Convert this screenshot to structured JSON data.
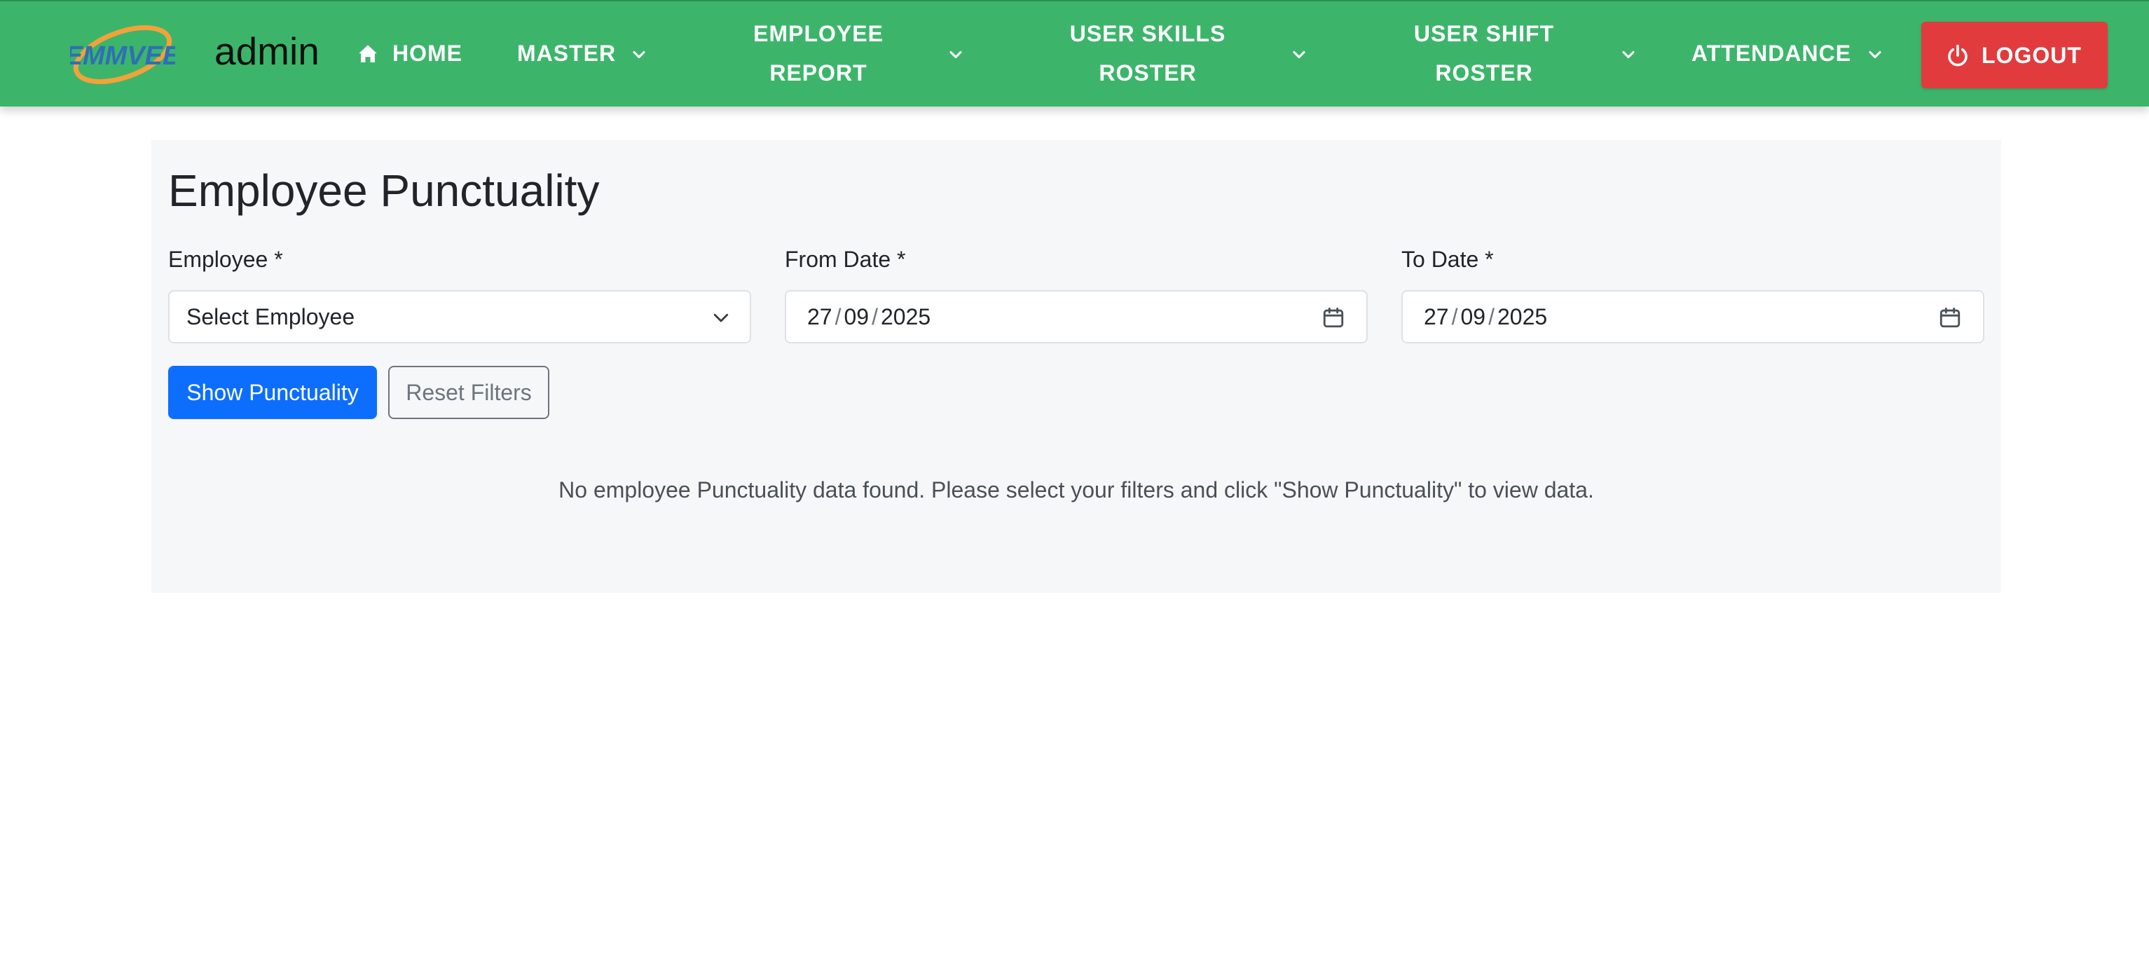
{
  "header": {
    "logo_text": "EMMVEE",
    "brand": "admin",
    "colors": {
      "navbar": "#3cb56b",
      "logout": "#e13b3e"
    },
    "nav": {
      "home": "HOME",
      "master": "MASTER",
      "employee_report_l1": "EMPLOYEE",
      "employee_report_l2": "REPORT",
      "user_skills_l1": "USER SKILLS",
      "user_skills_l2": "ROSTER",
      "user_shift_l1": "USER SHIFT",
      "user_shift_l2": "ROSTER",
      "attendance": "ATTENDANCE",
      "logout": "LOGOUT"
    }
  },
  "main": {
    "title": "Employee Punctuality",
    "employee": {
      "label": "Employee *",
      "value": "Select Employee"
    },
    "from_date": {
      "label": "From Date *",
      "day": "27",
      "month": "09",
      "year": "2025"
    },
    "to_date": {
      "label": "To Date *",
      "day": "27",
      "month": "09",
      "year": "2025"
    },
    "show_button": "Show Punctuality",
    "reset_button": "Reset Filters",
    "empty_message": "No employee Punctuality data found. Please select your filters and click \"Show Punctuality\" to view data.",
    "colors": {
      "primary": "#0d6efd",
      "secondary": "#6c757d"
    }
  }
}
